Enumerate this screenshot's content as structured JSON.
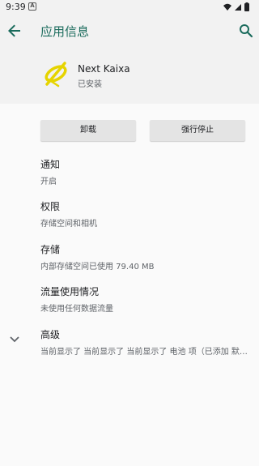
{
  "status_bar": {
    "time": "9:39",
    "notification_icon": "A"
  },
  "app_bar": {
    "title": "应用信息"
  },
  "app": {
    "name": "Next Kaixa",
    "status": "已安装"
  },
  "buttons": {
    "uninstall": "卸载",
    "force_stop": "强行停止"
  },
  "settings": [
    {
      "title": "通知",
      "subtitle": "开启"
    },
    {
      "title": "权限",
      "subtitle": "存储空间和相机"
    },
    {
      "title": "存储",
      "subtitle": "内部存储空间已使用 79.40 MB"
    },
    {
      "title": "流量使用情况",
      "subtitle": "未使用任何数据流量"
    },
    {
      "title": "高级",
      "subtitle": "当前显示了 当前显示了 当前显示了 电池 项（已添加 默认…"
    }
  ],
  "colors": {
    "accent": "#1a6b5c",
    "app_icon": "#e6d400"
  }
}
